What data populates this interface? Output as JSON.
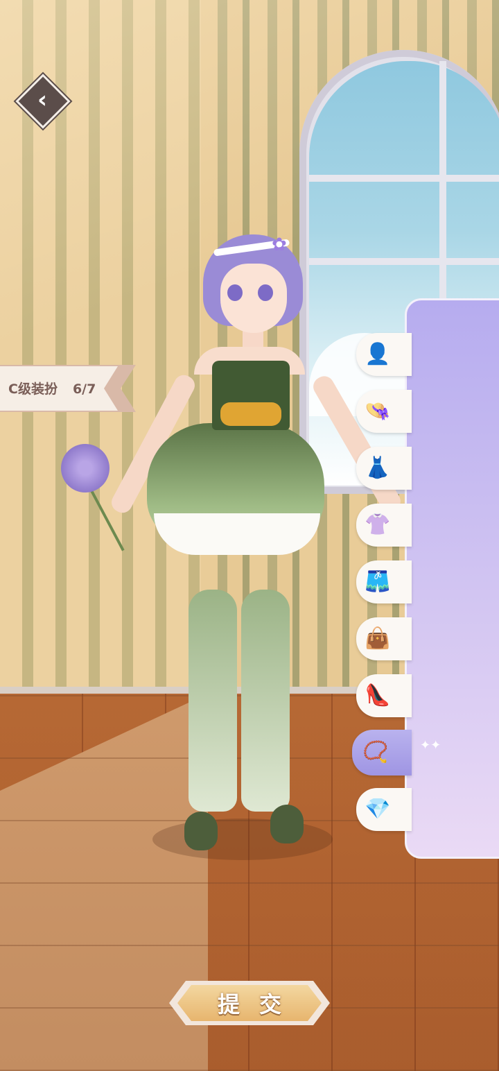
{
  "header": {
    "back_icon": "chevron-left-icon"
  },
  "level_banner": {
    "grade": "C级装扮",
    "progress": "6/7"
  },
  "categories": [
    {
      "id": "hair",
      "icon": "hair-icon",
      "glyph": "👤",
      "active": false
    },
    {
      "id": "hat",
      "icon": "hat-icon",
      "glyph": "👒",
      "active": false
    },
    {
      "id": "dress",
      "icon": "dress-icon",
      "glyph": "👗",
      "active": false
    },
    {
      "id": "top",
      "icon": "shirt-icon",
      "glyph": "👚",
      "active": false
    },
    {
      "id": "bottoms",
      "icon": "shorts-icon",
      "glyph": "🩳",
      "active": false
    },
    {
      "id": "bag",
      "icon": "bag-icon",
      "glyph": "👜",
      "active": false
    },
    {
      "id": "shoes",
      "icon": "high-heel-icon",
      "glyph": "👠",
      "active": false
    },
    {
      "id": "necklace",
      "icon": "necklace-icon",
      "glyph": "📿",
      "active": true
    },
    {
      "id": "earrings",
      "icon": "earring-icon",
      "glyph": "💎",
      "active": false
    }
  ],
  "submit": {
    "label": "提交"
  },
  "colors": {
    "panel_top": "#b6acef",
    "panel_bottom": "#eadaf5",
    "active_tab": "#9f95e3",
    "submit": "#e7b56e"
  }
}
